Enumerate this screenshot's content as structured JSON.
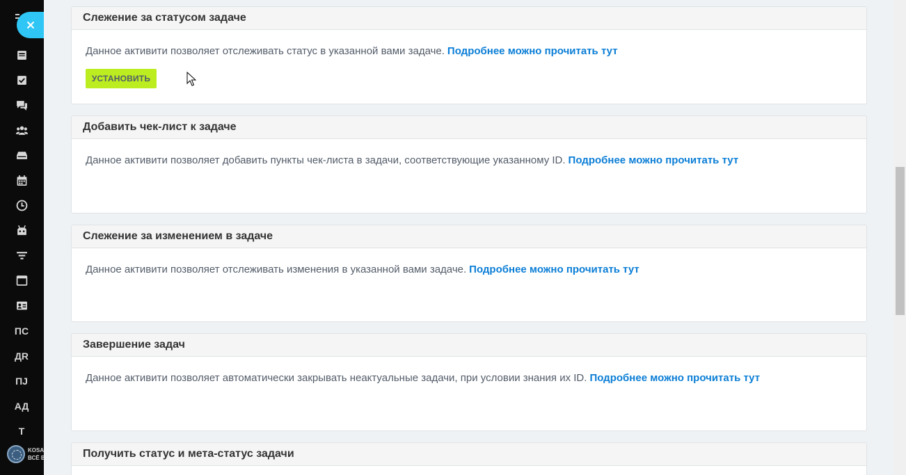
{
  "sidebar": {
    "icons": [
      "menu-icon",
      "news-icon",
      "tasks-icon",
      "chat-icon",
      "groups-icon",
      "drive-icon",
      "calendar-icon",
      "time-icon",
      "bot-icon",
      "filter-icon",
      "sites-icon",
      "contacts-icon"
    ],
    "text_items": [
      "ПС",
      "ДR",
      "ПJ",
      "АД",
      "Т"
    ],
    "logo_text": "KOSA\nВСЁ В"
  },
  "cards": [
    {
      "title": "Слежение за статусом задаче",
      "description": "Данное активити позволяет отслеживать статус в указанной вами задаче.",
      "link": "Подробнее можно прочитать тут",
      "button": "УСТАНОВИТЬ"
    },
    {
      "title": "Добавить чек-лист к задаче",
      "description": "Данное активити позволяет добавить пункты чек-листа в задачи, соответствующие указанному ID.",
      "link": "Подробнее можно прочитать тут"
    },
    {
      "title": "Слежение за изменением в задаче",
      "description": "Данное активити позволяет отслеживать изменения в указанной вами задаче.",
      "link": "Подробнее можно прочитать тут"
    },
    {
      "title": "Завершение задач",
      "description": "Данное активити позволяет автоматически закрывать неактуальные задачи, при условии знания их ID.",
      "link": "Подробнее можно прочитать тут"
    },
    {
      "title": "Получить статус и мета-статус задачи",
      "description": "",
      "link": ""
    }
  ],
  "colors": {
    "sidebar_bg": "#0b0b0b",
    "close_button": "#2fc6f6",
    "install_button": "#bbed21",
    "link": "#0b7ed6"
  }
}
